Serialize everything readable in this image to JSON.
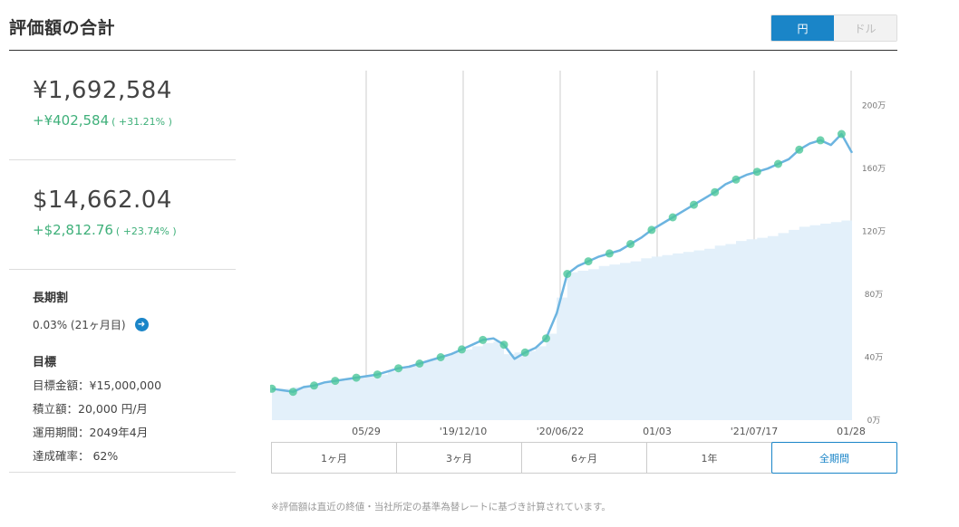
{
  "header": {
    "title": "評価額の合計",
    "currency_yen": "円",
    "currency_usd": "ドル"
  },
  "summary": {
    "jpy_value": "¥1,692,584",
    "jpy_gain": "+¥402,584",
    "jpy_gain_pct": "( +31.21% )",
    "usd_value": "$14,662.04",
    "usd_gain": "+$2,812.76",
    "usd_gain_pct": "( +23.74% )"
  },
  "long_term": {
    "title": "長期割",
    "rate": "0.03% (21ヶ月目)"
  },
  "goal": {
    "title": "目標",
    "amount": "目標金額：¥15,000,000",
    "monthly": "積立額：20,000 円/月",
    "period": "運用期間：2049年4月",
    "probability": "達成確率： 62%"
  },
  "periods": [
    "1ヶ月",
    "3ヶ月",
    "6ヶ月",
    "1年",
    "全期間"
  ],
  "footnote": "※評価額は直近の終値・当社所定の基準為替レートに基づき計算されています。",
  "colors": {
    "accent": "#1a85c8",
    "gain": "#3fb07a",
    "line": "#6cb4e0",
    "area": "#e3f0fa",
    "marker": "#4cc79a"
  },
  "chart_data": {
    "type": "line",
    "x_ticks": [
      "05/29",
      "'19/12/10",
      "'20/06/22",
      "01/03",
      "'21/07/17",
      "01/28"
    ],
    "y_ticks": [
      "0万",
      "40万",
      "80万",
      "120万",
      "160万",
      "200万"
    ],
    "ylim": [
      0,
      220
    ],
    "y_unit": "万円",
    "grid": "vertical",
    "series": [
      {
        "values": [
          20,
          19,
          18,
          21,
          22,
          24,
          25,
          26,
          27,
          28,
          29,
          31,
          33,
          34,
          36,
          38,
          40,
          42,
          45,
          48,
          51,
          52,
          48,
          39,
          43,
          46,
          52,
          68,
          93,
          98,
          101,
          104,
          106,
          108,
          112,
          116,
          121,
          125,
          129,
          133,
          137,
          141,
          145,
          150,
          153,
          156,
          158,
          160,
          163,
          166,
          172,
          176,
          178,
          175,
          182,
          170
        ]
      },
      {
        "values": [
          20,
          20,
          21,
          22,
          23,
          24,
          25,
          26,
          27,
          28,
          29,
          31,
          33,
          35,
          37,
          39,
          41,
          43,
          45,
          47,
          49,
          50,
          42,
          43,
          44,
          47,
          55,
          78,
          94,
          95,
          96,
          98,
          99,
          100,
          101,
          103,
          104,
          105,
          106,
          107,
          108,
          109,
          111,
          112,
          114,
          115,
          116,
          117,
          119,
          121,
          123,
          124,
          125,
          126,
          127,
          128
        ]
      }
    ]
  }
}
